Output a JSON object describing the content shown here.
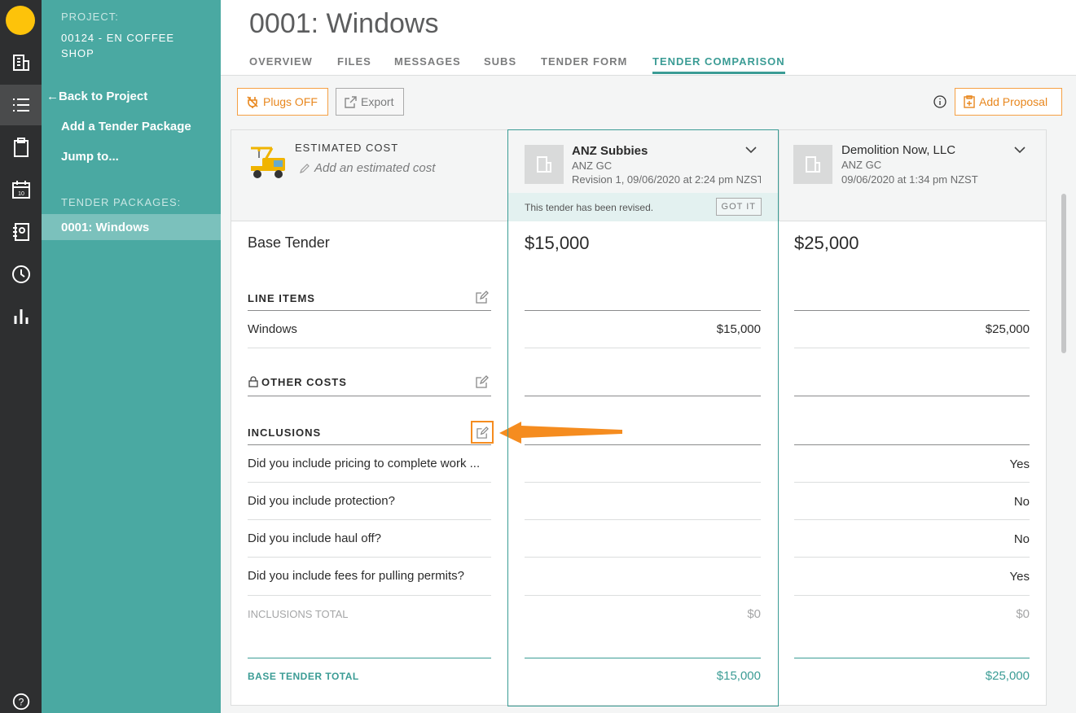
{
  "rail": {
    "icons": [
      "building-icon",
      "list-icon",
      "clipboard-icon",
      "calendar-icon",
      "contacts-icon",
      "clock-icon",
      "reports-icon"
    ],
    "calendar_day": "10",
    "help": "?"
  },
  "sidebar": {
    "project_label": "PROJECT:",
    "project_name": "00124 - EN COFFEE SHOP",
    "back_link": "Back to Project",
    "add_package": "Add a Tender Package",
    "jump_to": "Jump to...",
    "packages_label": "TENDER PACKAGES:",
    "packages": [
      "0001: Windows"
    ]
  },
  "header": {
    "title": "0001: Windows",
    "tabs": [
      "OVERVIEW",
      "FILES",
      "MESSAGES",
      "SUBS",
      "TENDER FORM",
      "TENDER COMPARISON"
    ],
    "active_tab": "TENDER COMPARISON"
  },
  "toolbar": {
    "plugs": "Plugs OFF",
    "export": "Export",
    "add_proposal": "Add Proposal"
  },
  "estimate": {
    "label": "ESTIMATED COST",
    "placeholder": "Add an estimated cost"
  },
  "vendors": [
    {
      "name": "ANZ Subbies",
      "company": "ANZ GC",
      "date": "Revision 1, 09/06/2020 at 2:24 pm NZST",
      "base": "$15,000",
      "windows": "$15,000",
      "answers": [
        "",
        "",
        "",
        ""
      ],
      "inclusions_total": "$0",
      "base_total": "$15,000"
    },
    {
      "name": "Demolition Now, LLC",
      "company": "ANZ GC",
      "date": "09/06/2020 at 1:34 pm NZST",
      "base": "$25,000",
      "windows": "$25,000",
      "answers": [
        "Yes",
        "No",
        "No",
        "Yes"
      ],
      "inclusions_total": "$0",
      "base_total": "$25,000"
    }
  ],
  "revised_notice": {
    "text": "This tender has been revised.",
    "button": "GOT IT"
  },
  "rows": {
    "base_tender": "Base Tender",
    "line_items": "LINE ITEMS",
    "windows": "Windows",
    "other_costs": "OTHER COSTS",
    "inclusions": "INCLUSIONS",
    "questions": [
      "Did you include pricing to complete work ...",
      "Did you include protection?",
      "Did you include haul off?",
      "Did you include fees for pulling permits?"
    ],
    "inclusions_total": "INCLUSIONS TOTAL",
    "base_tender_total": "BASE TENDER TOTAL"
  },
  "colors": {
    "teal": "#4aa9a2",
    "accent": "#3b9c95",
    "orange": "#f58c1f",
    "rail": "#2e2f30",
    "logo": "#fdc30a"
  }
}
